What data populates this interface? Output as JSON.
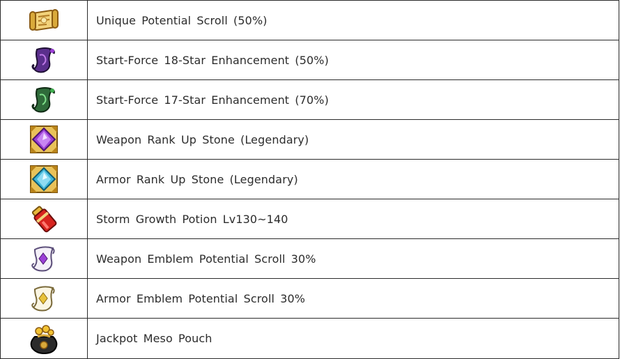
{
  "items": [
    {
      "name": "Unique Potential Scroll (50%)",
      "icon": "golden-scroll-icon"
    },
    {
      "name": "Start-Force 18-Star Enhancement (50%)",
      "icon": "purple-scroll-icon"
    },
    {
      "name": "Start-Force 17-Star Enhancement (70%)",
      "icon": "green-scroll-icon"
    },
    {
      "name": "Weapon Rank Up Stone (Legendary)",
      "icon": "purple-gem-icon"
    },
    {
      "name": "Armor Rank Up Stone (Legendary)",
      "icon": "blue-gem-icon"
    },
    {
      "name": "Storm Growth Potion Lv130~140",
      "icon": "red-potion-icon"
    },
    {
      "name": "Weapon Emblem Potential Scroll 30%",
      "icon": "purple-emblem-scroll-icon"
    },
    {
      "name": "Armor Emblem Potential Scroll 30%",
      "icon": "yellow-emblem-scroll-icon"
    },
    {
      "name": "Jackpot Meso Pouch",
      "icon": "meso-pouch-icon"
    }
  ],
  "colors": {
    "border": "#2b2b2b",
    "text": "#2c2c2c",
    "gold": "#d9a93a",
    "purple_gem": "#9b3fd6",
    "blue_gem": "#3fb6d9",
    "red_potion": "#d8241f"
  }
}
